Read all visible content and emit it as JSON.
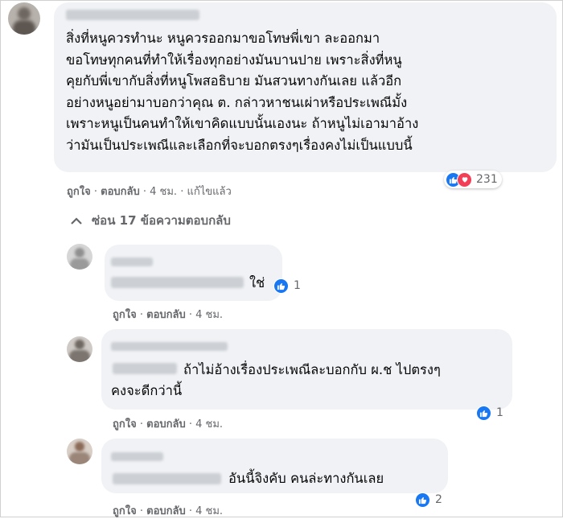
{
  "colors": {
    "bubble": "#f0f2f5",
    "like": "#1877f2",
    "love": "#f33e58",
    "meta": "#65676b"
  },
  "main_comment": {
    "author": "",
    "text": "สิ่งที่หนูควรทำนะ หนูควรออกมาขอโทษพี่เขา ละออกมา\nขอโทษทุกคนที่ทำให้เรื่องทุกอย่างมันบานปาย เพราะสิ่งที่หนู\nคุยกับพี่เขากับสิ่งที่หนูโพสอธิบาย มันสวนทางกันเลย แล้วอีก\nอย่างหนูอย่ามาบอกว่าคุณ ต. กล่าวหาชนเผ่าหรือประเพณีมั้ง\nเพราะหนูเป็นคนทำให้เขาคิดแบบนั้นเองนะ ถ้าหนูไม่เอามาอ้าง\nว่ามันเป็นประเพณีและเลือกที่จะบอกตรงๆเรื่องคงไม่เป็นแบบนี้",
    "reactions": {
      "icons": [
        "like-icon",
        "love-icon"
      ],
      "count": "231"
    },
    "actions": {
      "like": "ถูกใจ",
      "reply": "ตอบกลับ",
      "time": "4 ชม.",
      "edited": "แก้ไขแล้ว",
      "sep": " · "
    }
  },
  "replies_toggle": {
    "icon": "chevron-up-icon",
    "label": "ซ่อน 17 ข้อความตอบกลับ"
  },
  "replies": [
    {
      "text": "ใช่",
      "reactions": {
        "icons": [
          "like-icon"
        ],
        "count": "1"
      },
      "actions": {
        "like": "ถูกใจ",
        "reply": "ตอบกลับ",
        "time": "4 ชม."
      }
    },
    {
      "text": "ถ้าไม่อ้างเรื่องประเพณีละบอกกับ ผ.ช ไปตรงๆ\nคงจะดีกว่านี้",
      "reactions": {
        "icons": [
          "like-icon"
        ],
        "count": "1"
      },
      "actions": {
        "like": "ถูกใจ",
        "reply": "ตอบกลับ",
        "time": "4 ชม."
      }
    },
    {
      "text": "อันนี้จิงคับ คนล่ะทางกันเลย",
      "reactions": {
        "icons": [
          "like-icon"
        ],
        "count": "2"
      },
      "actions": {
        "like": "ถูกใจ",
        "reply": "ตอบกลับ",
        "time": "4 ชม."
      }
    }
  ]
}
